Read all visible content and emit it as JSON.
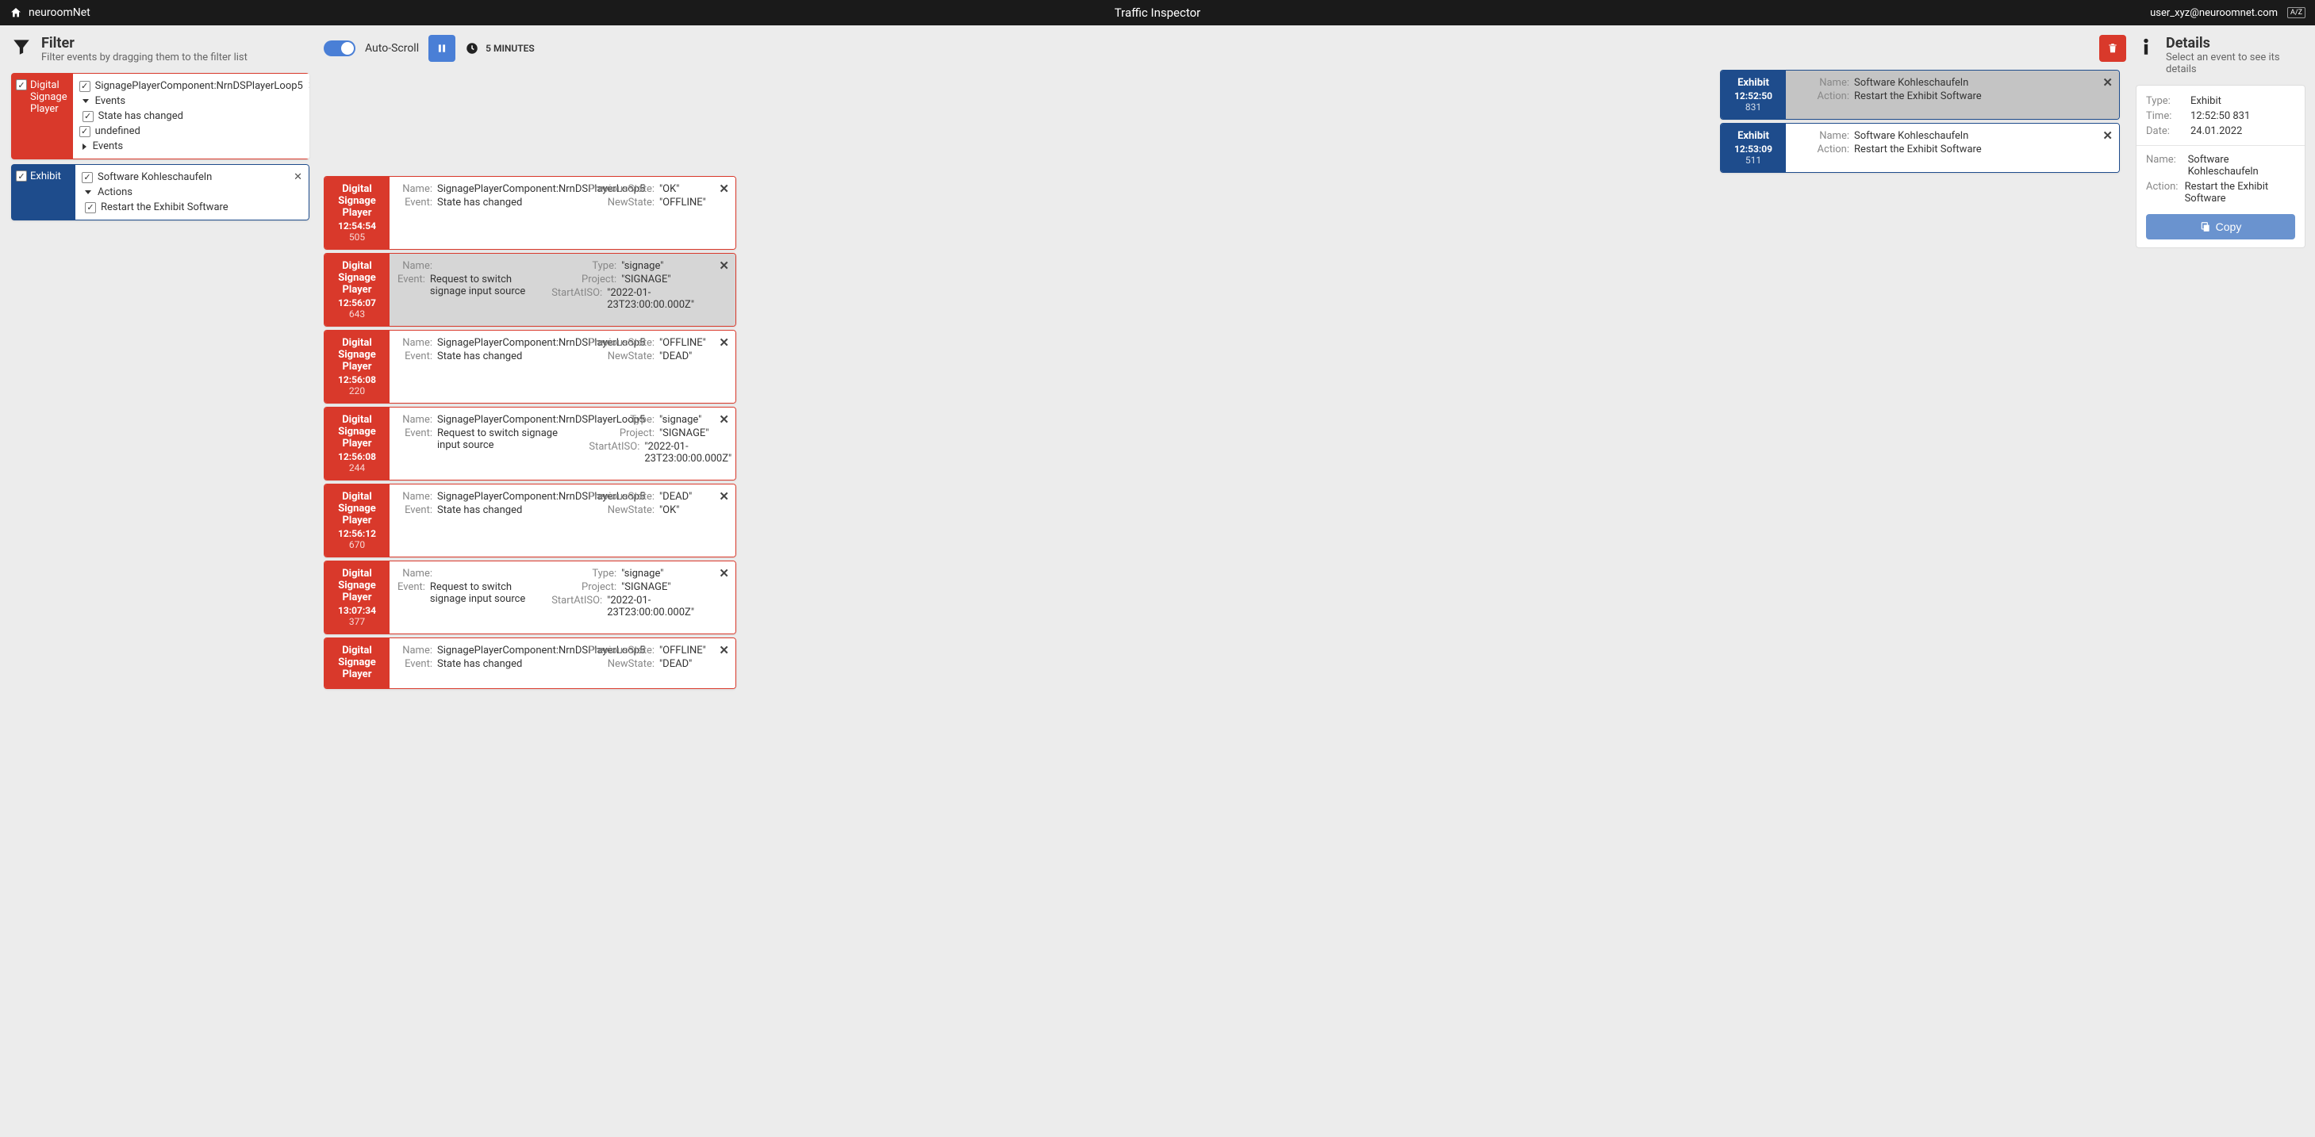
{
  "topbar": {
    "brand": "neuroomNet",
    "title": "Traffic Inspector",
    "user": "user_xyz@neuroomnet.com"
  },
  "filterPanel": {
    "title": "Filter",
    "subtitle": "Filter events by dragging them to the filter list"
  },
  "filters": [
    {
      "color": "red",
      "label": "Digital Signage Player",
      "rows": [
        {
          "text": "SignagePlayerComponent:NrnDSPlayerLoop5",
          "checked": true,
          "close": true
        },
        {
          "text": "Events",
          "caret": "down",
          "sub": true
        },
        {
          "text": "State has changed",
          "checked": true,
          "sub": true
        },
        {
          "text": "undefined",
          "checked": true
        },
        {
          "text": "Events",
          "caret": "right",
          "sub": true
        }
      ]
    },
    {
      "color": "blue",
      "label": "Exhibit",
      "rows": [
        {
          "text": "Software Kohleschaufeln",
          "checked": true,
          "close": true
        },
        {
          "text": "Actions",
          "caret": "down",
          "sub": true
        },
        {
          "text": "Restart the Exhibit Software",
          "checked": true,
          "sub": true
        }
      ]
    }
  ],
  "toolbar": {
    "autoScroll": "Auto-Scroll",
    "interval": "5 MINUTES"
  },
  "events": [
    {
      "side": "right",
      "color": "blue",
      "selected": true,
      "type": "Exhibit",
      "time": "12:52:50",
      "ms": "831",
      "cols": [
        [
          {
            "k": "Name:",
            "v": "Software Kohleschaufeln"
          },
          {
            "k": "Action:",
            "v": "Restart the Exhibit Software"
          }
        ]
      ]
    },
    {
      "side": "right",
      "color": "blue",
      "type": "Exhibit",
      "time": "12:53:09",
      "ms": "511",
      "cols": [
        [
          {
            "k": "Name:",
            "v": "Software Kohleschaufeln"
          },
          {
            "k": "Action:",
            "v": "Restart the Exhibit Software"
          }
        ]
      ]
    },
    {
      "side": "left",
      "color": "red",
      "type": "Digital Signage Player",
      "time": "12:54:54",
      "ms": "505",
      "cols": [
        [
          {
            "k": "Name:",
            "v": "SignagePlayerComponent:NrnDSPlayerLoop5"
          },
          {
            "k": "Event:",
            "v": "State has changed"
          }
        ],
        [
          {
            "k": "PreviousState:",
            "v": "\"OK\""
          },
          {
            "k": "NewState:",
            "v": "\"OFFLINE\""
          }
        ]
      ]
    },
    {
      "side": "left",
      "color": "red",
      "selected2": true,
      "type": "Digital Signage Player",
      "time": "12:56:07",
      "ms": "643",
      "cols": [
        [
          {
            "k": "Name:",
            "v": ""
          },
          {
            "k": "Event:",
            "v": "Request to switch signage input source"
          }
        ],
        [
          {
            "k": "Type:",
            "v": "\"signage\""
          },
          {
            "k": "Project:",
            "v": "\"SIGNAGE\""
          },
          {
            "k": "StartAtISO:",
            "v": "\"2022-01-23T23:00:00.000Z\""
          }
        ]
      ]
    },
    {
      "side": "left",
      "color": "red",
      "type": "Digital Signage Player",
      "time": "12:56:08",
      "ms": "220",
      "cols": [
        [
          {
            "k": "Name:",
            "v": "SignagePlayerComponent:NrnDSPlayerLoop5"
          },
          {
            "k": "Event:",
            "v": "State has changed"
          }
        ],
        [
          {
            "k": "PreviousState:",
            "v": "\"OFFLINE\""
          },
          {
            "k": "NewState:",
            "v": "\"DEAD\""
          }
        ]
      ]
    },
    {
      "side": "left",
      "color": "red",
      "type": "Digital Signage Player",
      "time": "12:56:08",
      "ms": "244",
      "cols": [
        [
          {
            "k": "Name:",
            "v": "SignagePlayerComponent:NrnDSPlayerLoop5"
          },
          {
            "k": "Event:",
            "v": "Request to switch signage input source"
          }
        ],
        [
          {
            "k": "Type:",
            "v": "\"signage\""
          },
          {
            "k": "Project:",
            "v": "\"SIGNAGE\""
          },
          {
            "k": "StartAtISO:",
            "v": "\"2022-01-23T23:00:00.000Z\""
          }
        ]
      ]
    },
    {
      "side": "left",
      "color": "red",
      "type": "Digital Signage Player",
      "time": "12:56:12",
      "ms": "670",
      "cols": [
        [
          {
            "k": "Name:",
            "v": "SignagePlayerComponent:NrnDSPlayerLoop5"
          },
          {
            "k": "Event:",
            "v": "State has changed"
          }
        ],
        [
          {
            "k": "PreviousState:",
            "v": "\"DEAD\""
          },
          {
            "k": "NewState:",
            "v": "\"OK\""
          }
        ]
      ]
    },
    {
      "side": "left",
      "color": "red",
      "type": "Digital Signage Player",
      "time": "13:07:34",
      "ms": "377",
      "cols": [
        [
          {
            "k": "Name:",
            "v": ""
          },
          {
            "k": "Event:",
            "v": "Request to switch signage input source"
          }
        ],
        [
          {
            "k": "Type:",
            "v": "\"signage\""
          },
          {
            "k": "Project:",
            "v": "\"SIGNAGE\""
          },
          {
            "k": "StartAtISO:",
            "v": "\"2022-01-23T23:00:00.000Z\""
          }
        ]
      ]
    },
    {
      "side": "left",
      "color": "red",
      "type": "Digital Signage Player",
      "time": "",
      "ms": "",
      "cols": [
        [
          {
            "k": "Name:",
            "v": "SignagePlayerComponent:NrnDSPlayerLoop5"
          },
          {
            "k": "Event:",
            "v": "State has changed"
          }
        ],
        [
          {
            "k": "PreviousState:",
            "v": "\"OFFLINE\""
          },
          {
            "k": "NewState:",
            "v": "\"DEAD\""
          }
        ]
      ]
    }
  ],
  "detailsPanel": {
    "title": "Details",
    "subtitle": "Select an event to see its details",
    "copy": "Copy",
    "rows1": [
      {
        "k": "Type:",
        "v": "Exhibit"
      },
      {
        "k": "Time:",
        "v": "12:52:50 831"
      },
      {
        "k": "Date:",
        "v": "24.01.2022"
      }
    ],
    "rows2": [
      {
        "k": "Name:",
        "v": "Software Kohleschaufeln"
      },
      {
        "k": "Action:",
        "v": "Restart the Exhibit Software"
      }
    ]
  }
}
